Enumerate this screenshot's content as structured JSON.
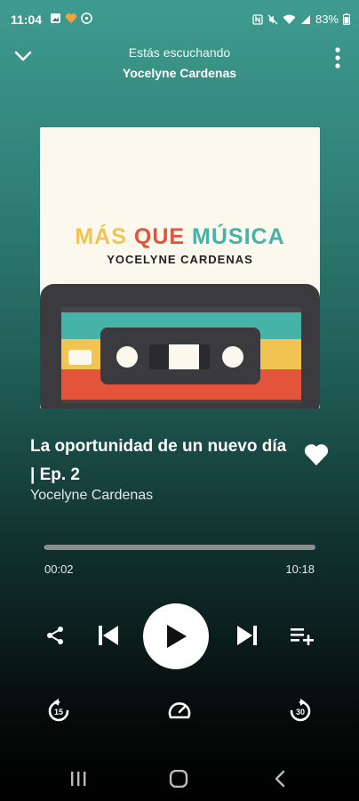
{
  "status_bar": {
    "time": "11:04",
    "battery": "83%",
    "left_icons": [
      "gallery-icon",
      "heart-app-icon",
      "game-icon"
    ],
    "right_icons": [
      "nfc-icon",
      "mute-icon",
      "wifi-icon",
      "signal-icon"
    ]
  },
  "header": {
    "subtitle": "Estás escuchando",
    "title": "Yocelyne Cardenas"
  },
  "cover": {
    "title_parts": [
      "MÁS",
      "QUE",
      "MÚSICA"
    ],
    "artist": "YOCELYNE CARDENAS",
    "colors": {
      "background": "#fbf8ee",
      "yellow": "#f2c453",
      "red": "#e4533c",
      "teal": "#46b3a8",
      "cassette": "#3a3a3f"
    }
  },
  "track": {
    "title": "La oportunidad de un nuevo día | Ep. 2",
    "artist": "Yocelyne Cardenas",
    "liked": true
  },
  "progress": {
    "elapsed": "00:02",
    "total": "10:18",
    "fraction": 0.003
  },
  "controls": {
    "share_icon": "share-icon",
    "previous_icon": "skip-previous-icon",
    "play_icon": "play-icon",
    "next_icon": "skip-next-icon",
    "queue_icon": "playlist-add-icon",
    "rewind_label": "15",
    "forward_label": "30",
    "speed_icon": "speedometer-icon"
  },
  "colors": {
    "gradient_top": "#3f9b8f",
    "gradient_bottom": "#000000",
    "accent": "#ffffff"
  }
}
